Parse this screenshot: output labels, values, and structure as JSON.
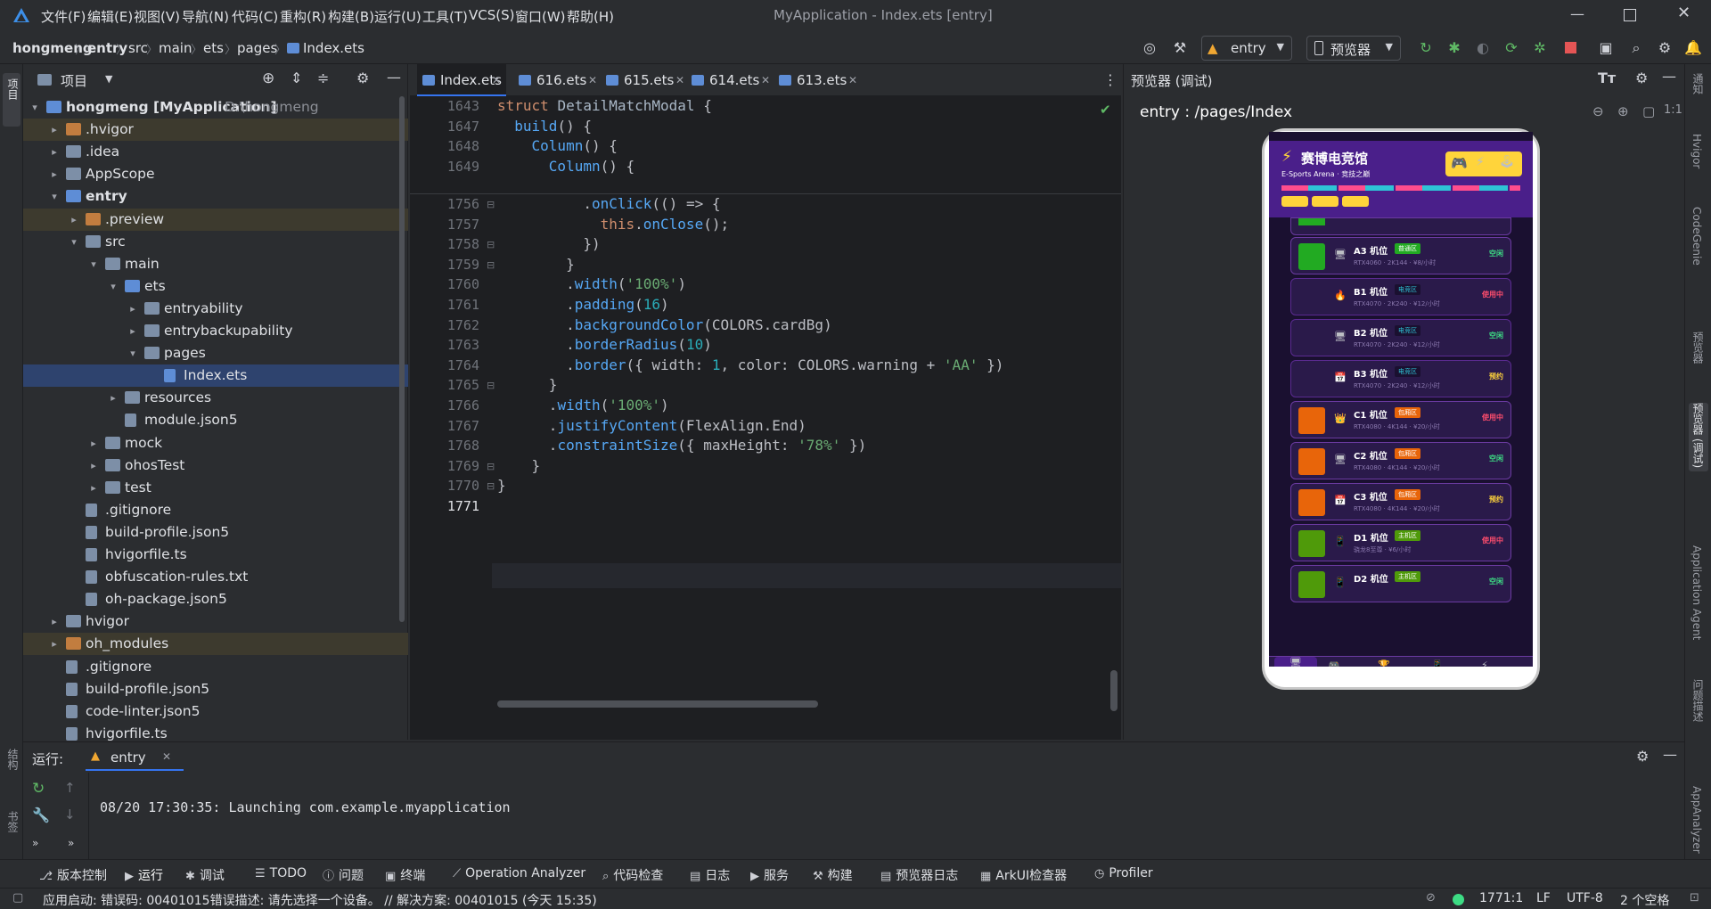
{
  "window": {
    "title": "MyApplication - Index.ets [entry]",
    "menus": [
      "文件(F)",
      "编辑(E)",
      "视图(V)",
      "导航(N)",
      "代码(C)",
      "重构(R)",
      "构建(B)",
      "运行(U)",
      "工具(T)",
      "VCS(S)",
      "窗口(W)",
      "帮助(H)"
    ]
  },
  "breadcrumb": [
    "hongmeng",
    "entry",
    "src",
    "main",
    "ets",
    "pages",
    "Index.ets"
  ],
  "toolbar": {
    "module": "entry",
    "previewer": "预览器"
  },
  "project": {
    "title": "项目",
    "rows": [
      {
        "label": "hongmeng [MyApplication]",
        "extra": "D:\\hongmeng",
        "depth": 0,
        "arrow": "▾",
        "type": "module"
      },
      {
        "label": ".hvigor",
        "depth": 1,
        "arrow": "▸",
        "type": "folder-orange"
      },
      {
        "label": ".idea",
        "depth": 1,
        "arrow": "▸",
        "type": "folder"
      },
      {
        "label": "AppScope",
        "depth": 1,
        "arrow": "▸",
        "type": "folder"
      },
      {
        "label": "entry",
        "depth": 1,
        "arrow": "▾",
        "type": "module"
      },
      {
        "label": ".preview",
        "depth": 2,
        "arrow": "▸",
        "type": "folder-orange"
      },
      {
        "label": "src",
        "depth": 2,
        "arrow": "▾",
        "type": "folder"
      },
      {
        "label": "main",
        "depth": 3,
        "arrow": "▾",
        "type": "folder"
      },
      {
        "label": "ets",
        "depth": 4,
        "arrow": "▾",
        "type": "folder-blue"
      },
      {
        "label": "entryability",
        "depth": 5,
        "arrow": "▸",
        "type": "folder"
      },
      {
        "label": "entrybackupability",
        "depth": 5,
        "arrow": "▸",
        "type": "folder"
      },
      {
        "label": "pages",
        "depth": 5,
        "arrow": "▾",
        "type": "folder"
      },
      {
        "label": "Index.ets",
        "depth": 6,
        "arrow": "",
        "type": "file-ets"
      },
      {
        "label": "resources",
        "depth": 4,
        "arrow": "▸",
        "type": "folder"
      },
      {
        "label": "module.json5",
        "depth": 4,
        "arrow": "",
        "type": "file"
      },
      {
        "label": "mock",
        "depth": 3,
        "arrow": "▸",
        "type": "folder"
      },
      {
        "label": "ohosTest",
        "depth": 3,
        "arrow": "▸",
        "type": "folder"
      },
      {
        "label": "test",
        "depth": 3,
        "arrow": "▸",
        "type": "folder"
      },
      {
        "label": ".gitignore",
        "depth": 2,
        "arrow": "",
        "type": "file"
      },
      {
        "label": "build-profile.json5",
        "depth": 2,
        "arrow": "",
        "type": "file"
      },
      {
        "label": "hvigorfile.ts",
        "depth": 2,
        "arrow": "",
        "type": "file"
      },
      {
        "label": "obfuscation-rules.txt",
        "depth": 2,
        "arrow": "",
        "type": "file"
      },
      {
        "label": "oh-package.json5",
        "depth": 2,
        "arrow": "",
        "type": "file"
      },
      {
        "label": "hvigor",
        "depth": 1,
        "arrow": "▸",
        "type": "folder"
      },
      {
        "label": "oh_modules",
        "depth": 1,
        "arrow": "▸",
        "type": "folder-orange"
      },
      {
        "label": ".gitignore",
        "depth": 1,
        "arrow": "",
        "type": "file"
      },
      {
        "label": "build-profile.json5",
        "depth": 1,
        "arrow": "",
        "type": "file"
      },
      {
        "label": "code-linter.json5",
        "depth": 1,
        "arrow": "",
        "type": "file"
      },
      {
        "label": "hvigorfile.ts",
        "depth": 1,
        "arrow": "",
        "type": "file"
      }
    ]
  },
  "editor": {
    "tabs": [
      "Index.ets",
      "616.ets",
      "615.ets",
      "614.ets",
      "613.ets"
    ],
    "sticky": [
      {
        "n": "1643",
        "code": "struct DetailMatchModal {"
      },
      {
        "n": "1647",
        "code": "  build() {"
      },
      {
        "n": "1648",
        "code": "    Column() {"
      },
      {
        "n": "1649",
        "code": "      Column() {"
      }
    ],
    "lines": [
      {
        "n": "1756",
        "code": "          .onClick(() => {"
      },
      {
        "n": "1757",
        "code": "            this.onClose();"
      },
      {
        "n": "1758",
        "code": "          })"
      },
      {
        "n": "1759",
        "code": "        }"
      },
      {
        "n": "1760",
        "code": "        .width('100%')"
      },
      {
        "n": "1761",
        "code": "        .padding(16)"
      },
      {
        "n": "1762",
        "code": "        .backgroundColor(COLORS.cardBg)"
      },
      {
        "n": "1763",
        "code": "        .borderRadius(10)"
      },
      {
        "n": "1764",
        "code": "        .border({ width: 1, color: COLORS.warning + 'AA' })"
      },
      {
        "n": "1765",
        "code": "      }"
      },
      {
        "n": "1766",
        "code": "      .width('100%')"
      },
      {
        "n": "1767",
        "code": "      .justifyContent(FlexAlign.End)"
      },
      {
        "n": "1768",
        "code": "      .constraintSize({ maxHeight: '78%' })"
      },
      {
        "n": "1769",
        "code": "    }"
      },
      {
        "n": "1770",
        "code": "}"
      },
      {
        "n": "1771",
        "code": ""
      }
    ]
  },
  "preview": {
    "title": "预览器 (调试)",
    "route": "entry : /pages/Index",
    "app_title": "赛博电竞馆",
    "app_subtitle": "E-Sports Arena · 竞技之巅",
    "cards": [
      {
        "name": "A3 机位",
        "badge": "普通区",
        "spec": "RTX4060 · 2K144 · ¥8/小时",
        "status": "空闲",
        "status_color": "#3ddc84",
        "color": "#22aa22",
        "badge_color": "#22aa22",
        "icon": "🖥"
      },
      {
        "name": "B1 机位",
        "badge": "电竞区",
        "spec": "RTX4070 · 2K240 · ¥12/小时",
        "status": "使用中",
        "status_color": "#ff4d6d",
        "color": "#2a1a4a",
        "badge_color": "#1a1030",
        "icon": "🔥"
      },
      {
        "name": "B2 机位",
        "badge": "电竞区",
        "spec": "RTX4070 · 2K240 · ¥12/小时",
        "status": "空闲",
        "status_color": "#3ddc84",
        "color": "#2a1a4a",
        "badge_color": "#1a1030",
        "icon": "🖥"
      },
      {
        "name": "B3 机位",
        "badge": "电竞区",
        "spec": "RTX4070 · 2K240 · ¥12/小时",
        "status": "预约",
        "status_color": "#ffd43b",
        "color": "#2a1a4a",
        "badge_color": "#1a1030",
        "icon": "📅"
      },
      {
        "name": "C1 机位",
        "badge": "包厢区",
        "spec": "RTX4080 · 4K144 · ¥20/小时",
        "status": "使用中",
        "status_color": "#ff4d6d",
        "color": "#e8650a",
        "badge_color": "#e8650a",
        "icon": "👑"
      },
      {
        "name": "C2 机位",
        "badge": "包厢区",
        "spec": "RTX4080 · 4K144 · ¥20/小时",
        "status": "空闲",
        "status_color": "#3ddc84",
        "color": "#e8650a",
        "badge_color": "#e8650a",
        "icon": "🖥"
      },
      {
        "name": "C3 机位",
        "badge": "包厢区",
        "spec": "RTX4080 · 4K144 · ¥20/小时",
        "status": "预约",
        "status_color": "#ffd43b",
        "color": "#e8650a",
        "badge_color": "#e8650a",
        "icon": "📅"
      },
      {
        "name": "D1 机位",
        "badge": "主机区",
        "spec": "骁龙8至尊 · ¥6/小时",
        "status": "使用中",
        "status_color": "#ff4d6d",
        "color": "#4f9a0a",
        "badge_color": "#4f9a0a",
        "icon": "📱"
      },
      {
        "name": "D2 机位",
        "badge": "主机区",
        "spec": "",
        "status": "空闲",
        "status_color": "#3ddc84",
        "color": "#4f9a0a",
        "badge_color": "#4f9a0a",
        "icon": "📱"
      }
    ]
  },
  "run": {
    "label": "运行:",
    "tab": "entry",
    "log": "08/20 17:30:35: Launching com.example.myapplication"
  },
  "bottom_tools": [
    "版本控制",
    "运行",
    "调试",
    "TODO",
    "问题",
    "终端",
    "Operation Analyzer",
    "代码检查",
    "日志",
    "服务",
    "构建",
    "预览器日志",
    "ArkUI检查器",
    "Profiler"
  ],
  "status": {
    "message": "应用启动: 错误码: 00401015错误描述: 请先选择一个设备。 // 解决方案: 00401015 (今天 15:35)",
    "position": "1771:1",
    "line_sep": "LF",
    "encoding": "UTF-8",
    "indent": "2 个空格"
  },
  "right_tools": [
    "通知",
    "Hvigor",
    "CodeGenie",
    "预览器",
    "预览器 (调试)",
    "Application Agent",
    "问题描述",
    "AppAnalyzer"
  ],
  "left_tools": [
    "项目",
    "结构",
    "书签"
  ]
}
